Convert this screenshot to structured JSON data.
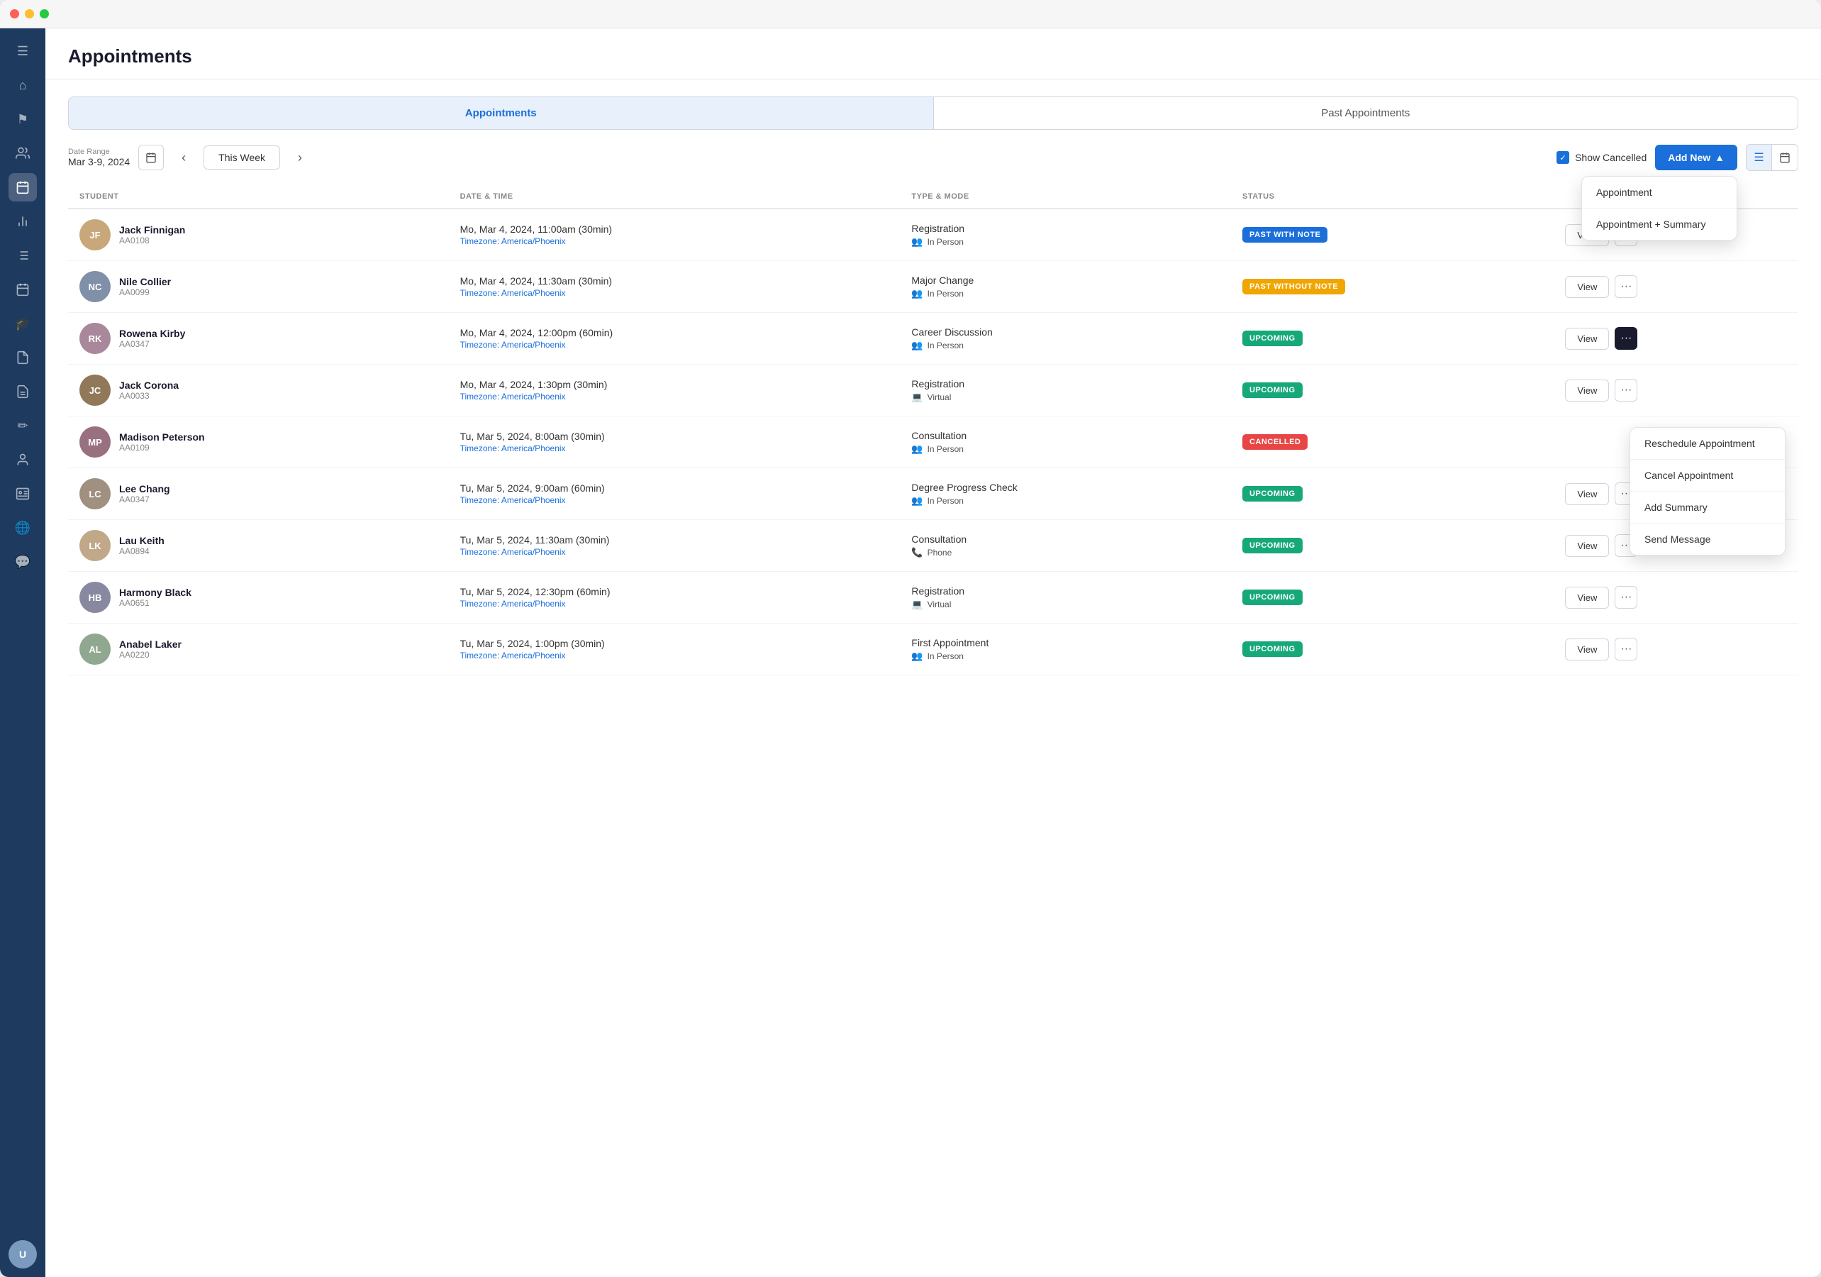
{
  "window": {
    "title": "Appointments"
  },
  "sidebar": {
    "icons": [
      {
        "name": "menu-icon",
        "symbol": "☰"
      },
      {
        "name": "home-icon",
        "symbol": "⌂"
      },
      {
        "name": "flag-icon",
        "symbol": "⚑"
      },
      {
        "name": "users-icon",
        "symbol": "👥"
      },
      {
        "name": "document-icon",
        "symbol": "📋"
      },
      {
        "name": "calendar-active-icon",
        "symbol": "📅"
      },
      {
        "name": "chart-icon",
        "symbol": "📊"
      },
      {
        "name": "list-icon",
        "symbol": "☰"
      },
      {
        "name": "calendar2-icon",
        "symbol": "🗓"
      },
      {
        "name": "graduation-icon",
        "symbol": "🎓"
      },
      {
        "name": "file-icon",
        "symbol": "📄"
      },
      {
        "name": "report-icon",
        "symbol": "📋"
      },
      {
        "name": "notes-icon",
        "symbol": "✏"
      },
      {
        "name": "people-icon",
        "symbol": "👤"
      },
      {
        "name": "contact-icon",
        "symbol": "📇"
      },
      {
        "name": "globe-icon",
        "symbol": "🌐"
      },
      {
        "name": "message-icon",
        "symbol": "💬"
      }
    ]
  },
  "page": {
    "title": "Appointments"
  },
  "tabs": [
    {
      "label": "Appointments",
      "active": true
    },
    {
      "label": "Past Appointments",
      "active": false
    }
  ],
  "toolbar": {
    "date_range_label": "Date Range",
    "date_range_value": "Mar 3-9, 2024",
    "this_week": "This Week",
    "show_cancelled": "Show Cancelled",
    "add_new": "Add New",
    "add_new_dropdown": [
      {
        "label": "Appointment"
      },
      {
        "label": "Appointment + Summary"
      }
    ],
    "views": [
      {
        "name": "list-view-icon",
        "symbol": "☰",
        "active": true
      },
      {
        "name": "calendar-view-icon",
        "symbol": "📅",
        "active": false
      }
    ]
  },
  "table": {
    "headers": [
      "STUDENT",
      "DATE & TIME",
      "TYPE & MODE",
      "STATUS",
      ""
    ],
    "rows": [
      {
        "student_name": "Jack Finnigan",
        "student_id": "AA0108",
        "avatar_initials": "JF",
        "avatar_class": "av1",
        "date_time": "Mo, Mar 4, 2024, 11:00am (30min)",
        "timezone": "Timezone: America/Phoenix",
        "type": "Registration",
        "mode": "In Person",
        "mode_icon": "👥",
        "status": "PAST WITH NOTE",
        "status_class": "badge-past-note",
        "show_view": true,
        "show_more": true
      },
      {
        "student_name": "Nile Collier",
        "student_id": "AA0099",
        "avatar_initials": "NC",
        "avatar_class": "av2",
        "date_time": "Mo, Mar 4, 2024, 11:30am (30min)",
        "timezone": "Timezone: America/Phoenix",
        "type": "Major Change",
        "mode": "In Person",
        "mode_icon": "👥",
        "status": "PAST WITHOUT NOTE",
        "status_class": "badge-past-no-note",
        "show_view": true,
        "show_more": true
      },
      {
        "student_name": "Rowena Kirby",
        "student_id": "AA0347",
        "avatar_initials": "RK",
        "avatar_class": "av3",
        "date_time": "Mo, Mar 4, 2024, 12:00pm (60min)",
        "timezone": "Timezone: America/Phoenix",
        "type": "Career Discussion",
        "mode": "In Person",
        "mode_icon": "👥",
        "status": "UPCOMING",
        "status_class": "badge-upcoming",
        "show_view": true,
        "show_more": true,
        "more_active": true
      },
      {
        "student_name": "Jack Corona",
        "student_id": "AA0033",
        "avatar_initials": "JC",
        "avatar_class": "av4",
        "date_time": "Mo, Mar 4, 2024, 1:30pm (30min)",
        "timezone": "Timezone: America/Phoenix",
        "type": "Registration",
        "mode": "Virtual",
        "mode_icon": "💻",
        "status": "UPCOMING",
        "status_class": "badge-upcoming",
        "show_view": true,
        "show_more": true
      },
      {
        "student_name": "Madison Peterson",
        "student_id": "AA0109",
        "avatar_initials": "MP",
        "avatar_class": "av5",
        "date_time": "Tu, Mar 5, 2024, 8:00am (30min)",
        "timezone": "Timezone: America/Phoenix",
        "type": "Consultation",
        "mode": "In Person",
        "mode_icon": "👥",
        "status": "CANCELLED",
        "status_class": "badge-cancelled",
        "show_view": false,
        "show_more": false
      },
      {
        "student_name": "Lee Chang",
        "student_id": "AA0347",
        "avatar_initials": "LC",
        "avatar_class": "av6",
        "date_time": "Tu, Mar 5, 2024, 9:00am (60min)",
        "timezone": "Timezone: America/Phoenix",
        "type": "Degree Progress Check",
        "mode": "In Person",
        "mode_icon": "👥",
        "status": "UPCOMING",
        "status_class": "badge-upcoming",
        "show_view": true,
        "show_more": true
      },
      {
        "student_name": "Lau Keith",
        "student_id": "AA0894",
        "avatar_initials": "LK",
        "avatar_class": "av7",
        "date_time": "Tu, Mar 5, 2024, 11:30am (30min)",
        "timezone": "Timezone: America/Phoenix",
        "type": "Consultation",
        "mode": "Phone",
        "mode_icon": "📞",
        "status": "UPCOMING",
        "status_class": "badge-upcoming",
        "show_view": true,
        "show_more": true
      },
      {
        "student_name": "Harmony Black",
        "student_id": "AA0651",
        "avatar_initials": "HB",
        "avatar_class": "av8",
        "date_time": "Tu, Mar 5, 2024, 12:30pm (60min)",
        "timezone": "Timezone: America/Phoenix",
        "type": "Registration",
        "mode": "Virtual",
        "mode_icon": "💻",
        "status": "UPCOMING",
        "status_class": "badge-upcoming",
        "show_view": true,
        "show_more": true
      },
      {
        "student_name": "Anabel Laker",
        "student_id": "AA0220",
        "avatar_initials": "AL",
        "avatar_class": "av9",
        "date_time": "Tu, Mar 5, 2024, 1:00pm (30min)",
        "timezone": "Timezone: America/Phoenix",
        "type": "First Appointment",
        "mode": "In Person",
        "mode_icon": "👥",
        "status": "UPCOMING",
        "status_class": "badge-upcoming",
        "show_view": true,
        "show_more": true
      }
    ]
  },
  "more_dropdown": {
    "items": [
      {
        "label": "Reschedule Appointment"
      },
      {
        "label": "Cancel Appointment"
      },
      {
        "label": "Add Summary"
      },
      {
        "label": "Send Message"
      }
    ]
  },
  "labels": {
    "view_btn": "View",
    "status_col": "STATUS"
  }
}
